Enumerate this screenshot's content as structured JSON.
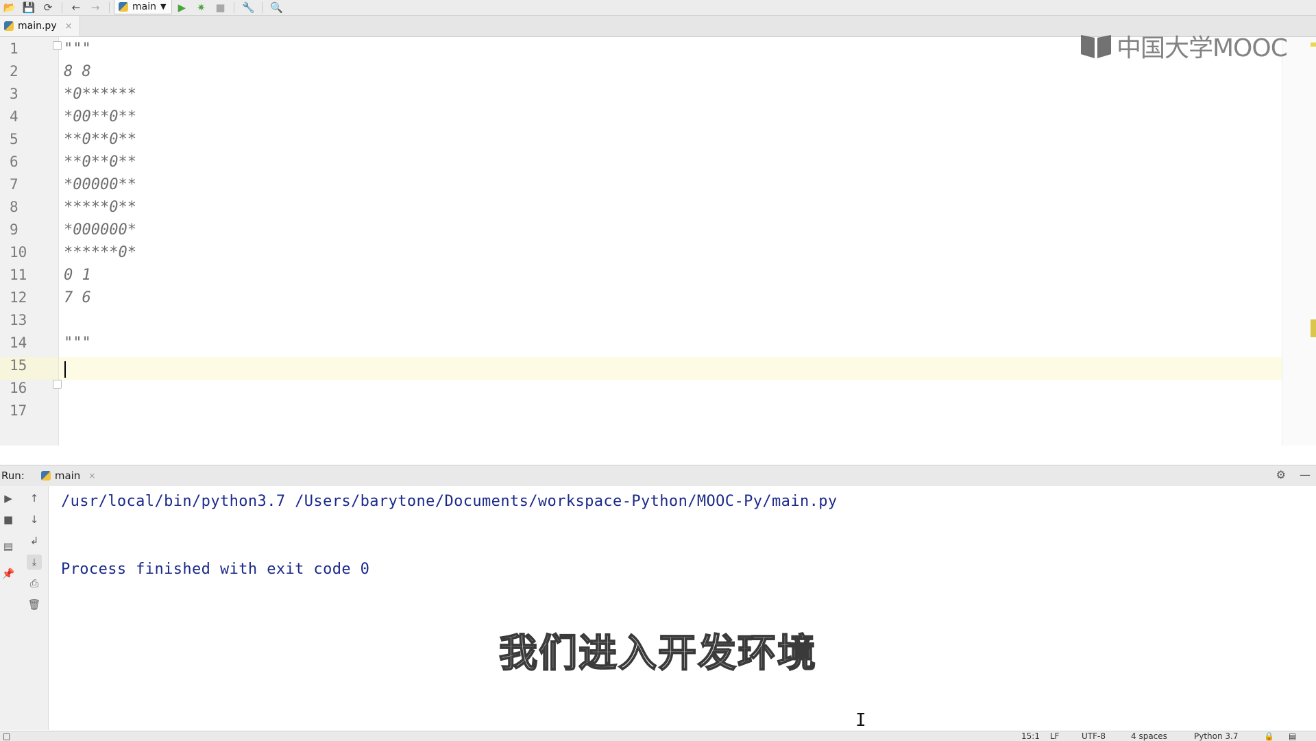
{
  "toolbar": {
    "run_config": "main"
  },
  "editor": {
    "tab": {
      "filename": "main.py",
      "close": "×"
    },
    "line_numbers": [
      "1",
      "2",
      "3",
      "4",
      "5",
      "6",
      "7",
      "8",
      "9",
      "10",
      "11",
      "12",
      "13",
      "14",
      "15",
      "16",
      "17"
    ],
    "lines": [
      "\"\"\"",
      "8 8",
      "*0******",
      "*00**0**",
      "**0**0**",
      "**0**0**",
      "*00000**",
      "*****0**",
      "*000000*",
      "******0*",
      "0 1",
      "7 6",
      "",
      "\"\"\"",
      "",
      "",
      ""
    ],
    "current_line": 15
  },
  "watermark": {
    "text": "中国大学MOOC"
  },
  "run_panel": {
    "label": "Run:",
    "tab": "main",
    "console_lines": [
      "/usr/local/bin/python3.7 /Users/barytone/Documents/workspace-Python/MOOC-Py/main.py",
      "",
      "",
      "Process finished with exit code 0"
    ]
  },
  "subtitle": "我们进入开发环境",
  "status_bar": {
    "position": "15:1",
    "line_separator": "LF",
    "encoding": "UTF-8",
    "indent": "4 spaces",
    "interpreter": "Python 3.7"
  }
}
